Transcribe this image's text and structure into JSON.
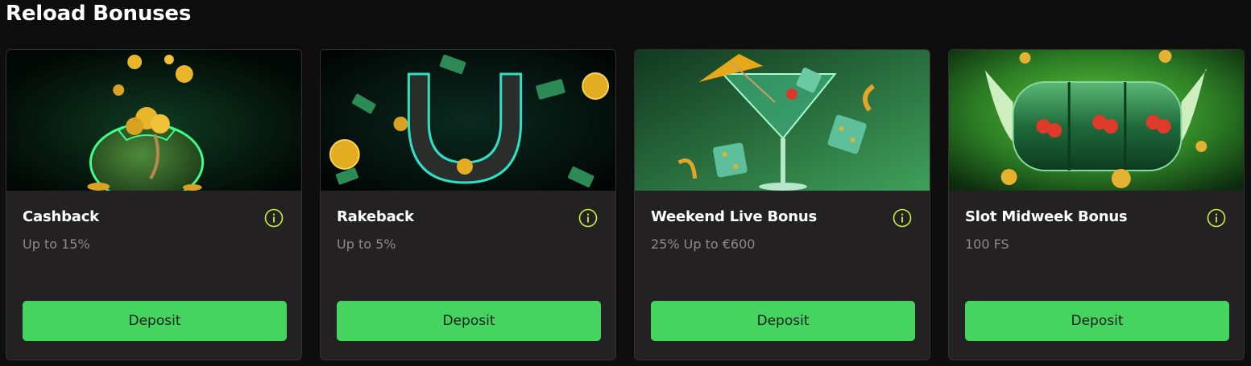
{
  "section": {
    "title": "Reload Bonuses"
  },
  "colors": {
    "background": "#0f0e0e",
    "card": "#232121",
    "accent_green": "#46d460",
    "info_icon": "#c8f03c",
    "subtitle": "#8c8989"
  },
  "cards": [
    {
      "title": "Cashback",
      "subtitle": "Up to 15%",
      "button": "Deposit",
      "image_icon": "money-bag-illustration",
      "info_icon": "info-icon"
    },
    {
      "title": "Rakeback",
      "subtitle": "Up to 5%",
      "button": "Deposit",
      "image_icon": "horseshoe-illustration",
      "info_icon": "info-icon"
    },
    {
      "title": "Weekend Live Bonus",
      "subtitle": "25% Up to €600",
      "button": "Deposit",
      "image_icon": "cocktail-dice-illustration",
      "info_icon": "info-icon"
    },
    {
      "title": "Slot Midweek Bonus",
      "subtitle": "100 FS",
      "button": "Deposit",
      "image_icon": "winged-slot-illustration",
      "info_icon": "info-icon"
    }
  ]
}
